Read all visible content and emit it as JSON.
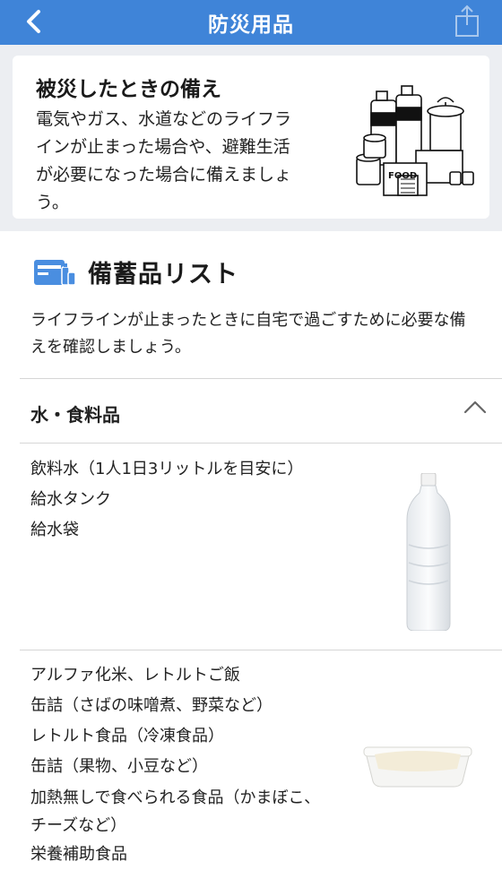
{
  "navbar": {
    "title": "防災用品",
    "back_icon": "chevron-left-icon",
    "share_icon": "share-icon"
  },
  "intro": {
    "heading": "被災したときの備え",
    "text": "電気やガス、水道などのライフラインが止まった場合や、避難生活が必要になった場合に備えましょう。",
    "illustration_label": "FOOD"
  },
  "stockpile": {
    "title": "備蓄品リスト",
    "description": "ライフラインが止まったときに自宅で過ごすために必要な備えを確認しましょう。"
  },
  "category": {
    "title": "水・食料品",
    "expanded": true,
    "groups": [
      {
        "items": [
          "飲料水（1人1日3リットルを目安に）",
          "給水タンク",
          "給水袋"
        ],
        "image": "water-bottle"
      },
      {
        "items": [
          "アルファ化米、レトルトご飯",
          "缶詰（さばの味噌煮、野菜など）",
          "レトルト食品（冷凍食品）",
          "缶詰（果物、小豆など）",
          "加熱無しで食べられる食品（かまぼこ、チーズなど）",
          "栄養補助食品"
        ],
        "image": "rice-tray"
      }
    ]
  },
  "colors": {
    "navbar": "#3f84d8",
    "background": "#eceef2",
    "icon_blue": "#4a8ee0"
  }
}
